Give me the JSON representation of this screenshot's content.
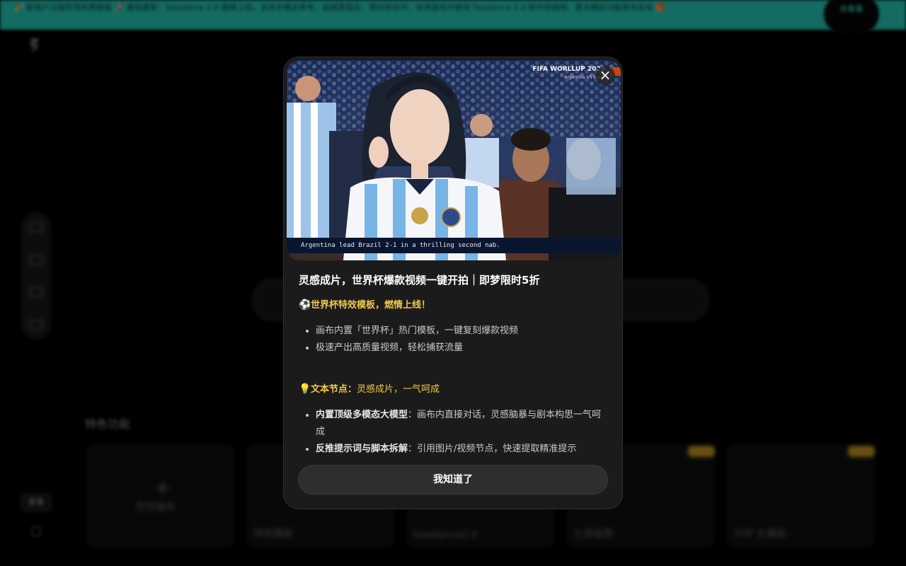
{
  "background": {
    "banner_text": "🎉 新用户注册即得免费额度 🚀 重磅更新：Seedance 2.0 震撼上线，支持多模态参考，画面更稳定，限时体验中，快来画布中使用 Seedance 2.0 制作视频吧，更多精彩功能等你发现 🎁",
    "banner_cta": "去看看",
    "section_title": "特色功能",
    "side_bottom_label": "登录",
    "cards": [
      {
        "caption": "空白画布"
      },
      {
        "caption": "特效模板"
      },
      {
        "caption": "Seedance2.0"
      },
      {
        "caption": "九宫格图"
      },
      {
        "caption": "TOP 主播版"
      }
    ]
  },
  "modal": {
    "hero": {
      "tag_line1": "FIFA WORLLUP 2025",
      "tag_line2": "Argentina VS Brazil",
      "caption": "Argentina lead Brazil 2-1 in a thrilling second nab."
    },
    "close_label": "×",
    "title": "灵感成片，世界杯爆款视频一键开拍｜即梦限时5折",
    "sections": [
      {
        "icon": "⚽",
        "heading": "世界杯特效模板，燃情上线！",
        "items": [
          {
            "bold": "",
            "text": "画布内置「世界杯」热门模板，一键复刻爆款视频"
          },
          {
            "bold": "",
            "text": "极速产出高质量视频，轻松捕获流量"
          }
        ]
      },
      {
        "icon": "💡",
        "heading": "文本节点：",
        "heading_rest": "灵感成片，一气呵成",
        "items": [
          {
            "bold": "内置顶级多模态大模型",
            "text": "：画布内直接对话，灵感脑暴与剧本构思一气呵成"
          },
          {
            "bold": "反推提示词与脚本拆解",
            "text": "：引用图片/视频节点，快速提取精准提示"
          }
        ]
      }
    ],
    "ok_label": "我知道了"
  },
  "colors": {
    "banner": "#1fa595",
    "modal_bg": "#1b1b1c",
    "accent_yellow": "#f2c94c",
    "button_bg": "#2e2e30"
  }
}
